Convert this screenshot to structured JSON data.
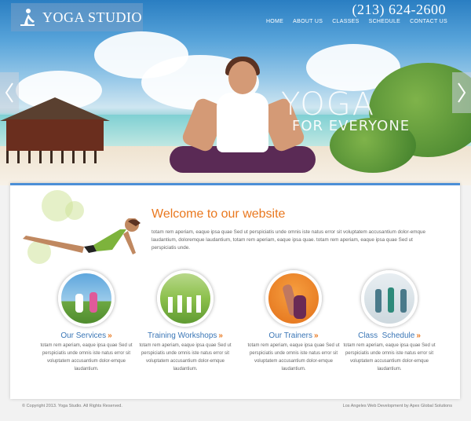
{
  "brand": {
    "name": "YOGA STUDIO",
    "phone": "(213) 624-2600"
  },
  "nav": [
    {
      "label": "HOME"
    },
    {
      "label": "ABOUT US"
    },
    {
      "label": "CLASSES"
    },
    {
      "label": "SCHEDULE"
    },
    {
      "label": "CONTACT US"
    }
  ],
  "hero": {
    "line1": "YOGA",
    "line2": "FOR EVERYONE"
  },
  "welcome": {
    "title": "Welcome to our website",
    "body": "totam rem aperiam, eaque ipsa quae Sed ut perspiciatis unde omnis iste natus error sit voluptatem accusantium dolor-emque laudantium, doloremque laudantium, totam rem aperiam, eaque ipsa quae. totam rem aperiam, eaque ipsa quae Sed ut perspiciatis unde."
  },
  "services": [
    {
      "title": "Our Services",
      "arrow": "»",
      "text": "totam rem aperiam, eaque ipsa quae Sed ut perspiciatis unde omnis iste natus error sit voluptatem accusantium dolor-emque laudantium."
    },
    {
      "title": "Training Workshops",
      "arrow": "»",
      "text": "totam rem aperiam, eaque ipsa quae Sed ut perspiciatis unde omnis iste natus error sit voluptatem accusantium dolor-emque laudantium."
    },
    {
      "title": "Our Trainers",
      "arrow": "»",
      "text": "totam rem aperiam, eaque ipsa quae Sed ut perspiciatis unde omnis iste natus error sit voluptatem accusantium dolor-emque laudantium."
    },
    {
      "title": "Class  Schedule",
      "arrow": "»",
      "text": "totam rem aperiam, eaque ipsa quae Sed ut perspiciatis unde omnis iste natus error sit voluptatem accusantium dolor-emque laudantium."
    }
  ],
  "footer": {
    "copyright": "© Copyright 2013. Yoga Studio. All Rights Reserved.",
    "credit": "Los Angeles Web Development by Apex Global Solutions"
  },
  "colors": {
    "accent": "#e9781f",
    "link": "#3a76b6",
    "panel_border": "#4c8fd6"
  },
  "icons": [
    "yoga-pose-logo-icon",
    "chevron-left-icon",
    "chevron-right-icon",
    "double-chevron-right-icon"
  ]
}
